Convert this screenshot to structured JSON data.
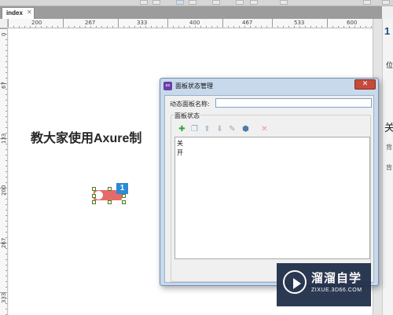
{
  "tab": {
    "label": "index",
    "close": "✕"
  },
  "rulers": {
    "horizontal": [
      "200",
      "267",
      "333",
      "400",
      "467",
      "533",
      "600"
    ],
    "vertical": [
      "0",
      "67",
      "133",
      "200",
      "267",
      "333"
    ]
  },
  "canvas": {
    "title": "教大家使用Axure制",
    "badge": "1",
    "switch_color": "#e76a6a"
  },
  "right_panel": {
    "number": "1",
    "label_pos": "位",
    "heading": "关",
    "label_1": "背",
    "label_2": "背"
  },
  "dialog": {
    "title": "面板状态管理",
    "icon_text": "ax",
    "close": "✕",
    "name_label": "动态面板名称:",
    "name_value": "",
    "group_label": "面板状态",
    "toolbar": [
      {
        "name": "add-icon",
        "glyph": "✚",
        "color": "#2fa52f"
      },
      {
        "name": "duplicate-icon",
        "glyph": "❐",
        "color": "#8aa6c4"
      },
      {
        "name": "move-up-icon",
        "glyph": "⬆",
        "color": "#a9bfd6"
      },
      {
        "name": "move-down-icon",
        "glyph": "⬇",
        "color": "#a9bfd6"
      },
      {
        "name": "edit-state-icon",
        "glyph": "✎",
        "color": "#9aa9b8"
      },
      {
        "name": "edit-all-icon",
        "glyph": "⬢",
        "color": "#4d7aa8"
      },
      {
        "name": "delete-icon",
        "glyph": "✕",
        "color": "#e89a9a"
      }
    ],
    "states": [
      "关",
      "开"
    ]
  },
  "watermark": {
    "cn": "溜溜自学",
    "en": "ZIXUE.3D66.COM"
  }
}
